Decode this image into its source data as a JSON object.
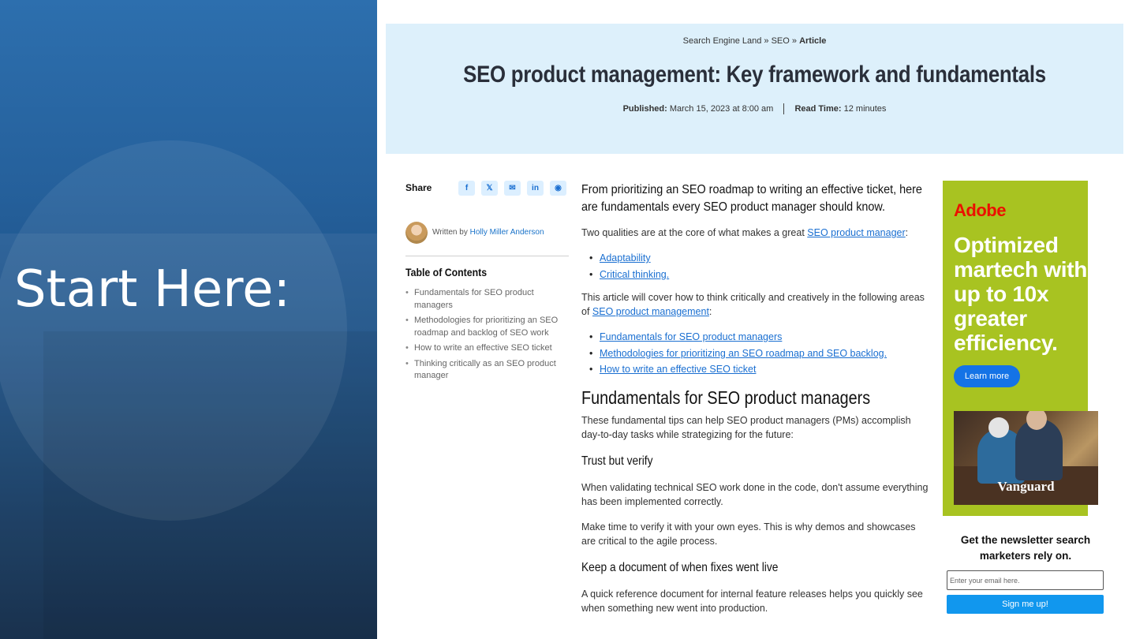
{
  "slide": {
    "title": "Start Here:"
  },
  "breadcrumb": {
    "site": "Search Engine Land",
    "sep1": "»",
    "section": "SEO",
    "sep2": "»",
    "current": "Article"
  },
  "article": {
    "title": "SEO product management: Key framework and fundamentals",
    "published_label": "Published:",
    "published_value": "March 15, 2023 at 8:00 am",
    "readtime_label": "Read Time:",
    "readtime_value": "12 minutes"
  },
  "share": {
    "label": "Share",
    "buttons": [
      {
        "icon": "facebook-icon",
        "glyph": "f"
      },
      {
        "icon": "x-icon",
        "glyph": "𝕏"
      },
      {
        "icon": "email-icon",
        "glyph": "✉"
      },
      {
        "icon": "linkedin-icon",
        "glyph": "in"
      },
      {
        "icon": "reddit-icon",
        "glyph": "◉"
      }
    ]
  },
  "author": {
    "prefix": "Written by",
    "name": "Holly Miller Anderson"
  },
  "toc": {
    "title": "Table of Contents",
    "items": [
      "Fundamentals for SEO product managers",
      "Methodologies for prioritizing an SEO roadmap and backlog of SEO work",
      "How to write an effective SEO ticket",
      "Thinking critically as an SEO product manager"
    ]
  },
  "content": {
    "lead": "From prioritizing an SEO roadmap to writing an effective ticket, here are fundamentals every SEO product manager should know.",
    "p1_before": "Two qualities are at the core of what makes a great",
    "p1_link": "SEO product manager",
    "p1_after": ":",
    "qualities": [
      "Adaptability",
      "Critical thinking."
    ],
    "p2_before": "This article will cover how to think critically and creatively in the following areas of",
    "p2_link": "SEO product management",
    "p2_after": ":",
    "areas": [
      "Fundamentals for SEO product managers",
      "Methodologies for prioritizing an SEO roadmap and SEO backlog.",
      "How to write an effective SEO ticket"
    ],
    "h2": "Fundamentals for SEO product managers",
    "p3": "These fundamental tips can help SEO product managers (PMs) accomplish day-to-day tasks while strategizing for the future:",
    "h3a": "Trust but verify",
    "p4": "When validating technical SEO work done in the code, don't assume everything has been implemented correctly.",
    "p5": "Make time to verify it with your own eyes. This is why demos and showcases are critical to the agile process.",
    "h3b": "Keep a document of when fixes went live",
    "p6": "A quick reference document for internal feature releases helps you quickly see when something new went into production."
  },
  "ad": {
    "brand": "Adobe",
    "headline": "Optimized martech with up to 10x greater efficiency.",
    "cta": "Learn more",
    "photo_logo": "Vanguard",
    "colors": {
      "bg": "#a8c321",
      "brand": "#eb1000",
      "cta": "#1473e6"
    }
  },
  "newsletter": {
    "title": "Get the newsletter search marketers rely on.",
    "placeholder": "Enter your email here.",
    "button": "Sign me up!"
  }
}
